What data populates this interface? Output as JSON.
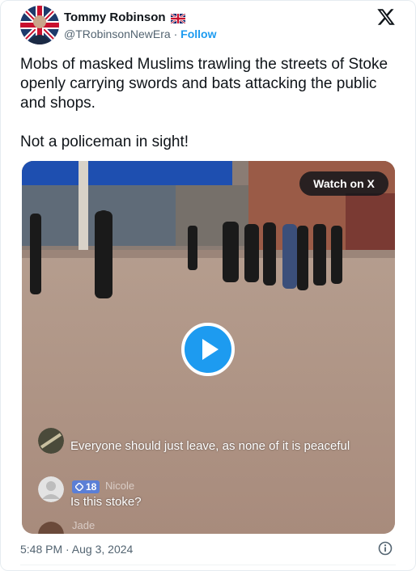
{
  "author": {
    "display_name": "Tommy Robinson",
    "handle": "@TRobinsonNewEra",
    "separator": "·",
    "follow_label": "Follow",
    "flag_icon": "uk-flag-icon"
  },
  "tweet": {
    "text": "Mobs of masked Muslims trawling the streets of Stoke openly carrying swords and bats attacking the public and shops.\n\nNot a policeman in sight!",
    "timestamp": "5:48 PM · Aug 3, 2024"
  },
  "video": {
    "watch_label": "Watch on X",
    "comments": [
      {
        "text": "Everyone should just leave, as none of it is peaceful"
      },
      {
        "badge_count": "18",
        "name": "Nicole",
        "text": "Is this stoke?"
      },
      {
        "name": "Jade"
      }
    ]
  },
  "colors": {
    "accent": "#1d9bf0",
    "text": "#0f1419",
    "secondary": "#536471"
  }
}
